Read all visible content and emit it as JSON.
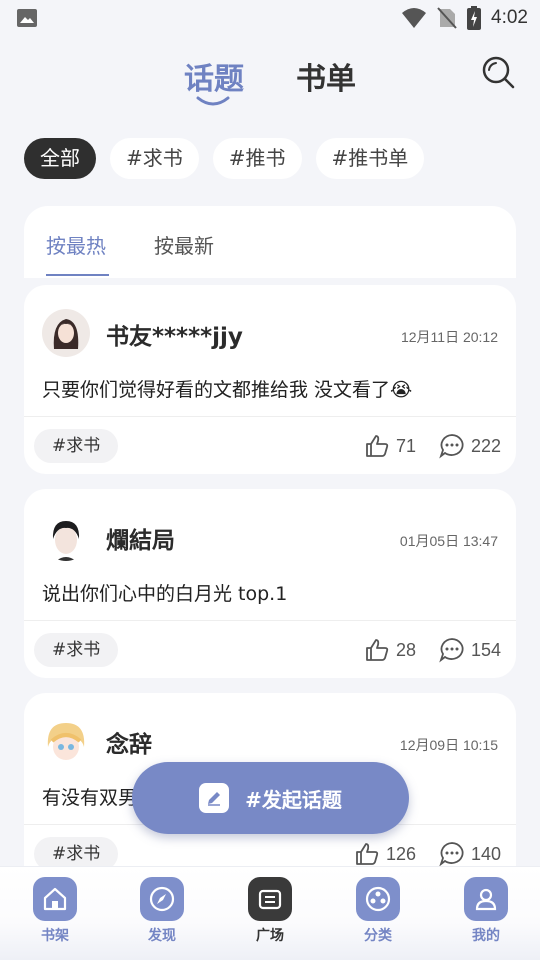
{
  "status_bar": {
    "time": "4:02"
  },
  "header": {
    "tabs": [
      {
        "label": "话题",
        "active": true
      },
      {
        "label": "书单",
        "active": false
      }
    ]
  },
  "filters": [
    "全部",
    "#求书",
    "#推书",
    "#推书单"
  ],
  "sort": {
    "options": [
      "按最热",
      "按最新"
    ],
    "active": "按最热"
  },
  "posts": [
    {
      "username": "书友*****jjy",
      "time": "12月11日 20:12",
      "content": "只要你们觉得好看的文都推给我 没文看了😭",
      "tag": "#求书",
      "likes": "71",
      "comments": "222"
    },
    {
      "username": "爛結局",
      "time": "01月05日 13:47",
      "content": "说出你们心中的白月光 top.1",
      "tag": "#求书",
      "likes": "28",
      "comments": "154"
    },
    {
      "username": "念辞",
      "time": "12月09日 10:15",
      "content": "有没有双男",
      "tag": "#求书",
      "likes": "126",
      "comments": "140"
    }
  ],
  "fab": {
    "label": "#发起话题"
  },
  "bottom_nav": [
    {
      "label": "书架",
      "icon": "home-icon",
      "active": false
    },
    {
      "label": "发现",
      "icon": "compass-icon",
      "active": false
    },
    {
      "label": "广场",
      "icon": "plaza-icon",
      "active": true
    },
    {
      "label": "分类",
      "icon": "category-icon",
      "active": false
    },
    {
      "label": "我的",
      "icon": "profile-icon",
      "active": false
    }
  ],
  "colors": {
    "accent": "#6f82c2",
    "fab": "#7889c6",
    "dark_chip": "#2f2f2f",
    "background": "#f4f5f9"
  }
}
